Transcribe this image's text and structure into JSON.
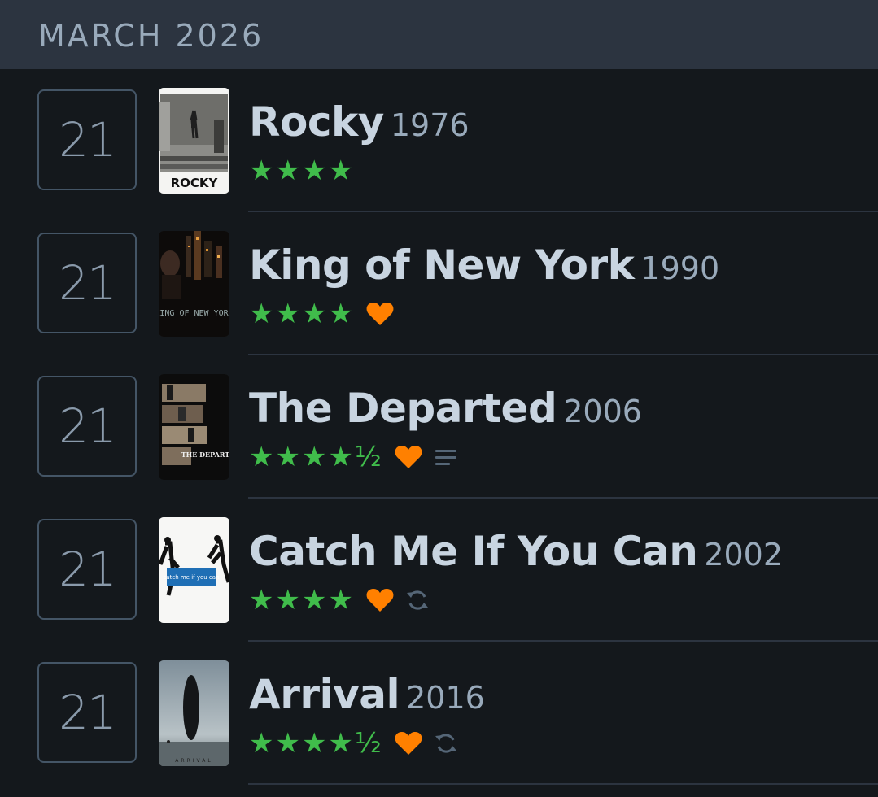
{
  "month": "MARCH 2026",
  "colors": {
    "header_bg": "#2c3440",
    "page_bg": "#14181c",
    "star": "#40bc4b",
    "heart": "#ff8000",
    "muted_icon": "#678"
  },
  "entries": [
    {
      "day": "21",
      "title": "Rocky",
      "year": "1976",
      "rating_text": "★★★★",
      "rating": 4,
      "liked": false,
      "review": false,
      "rewatch": false,
      "poster_text": "ROCKY"
    },
    {
      "day": "21",
      "title": "King of New York",
      "year": "1990",
      "rating_text": "★★★★",
      "rating": 4,
      "liked": true,
      "review": false,
      "rewatch": false,
      "poster_text": "KING OF NEW YORK"
    },
    {
      "day": "21",
      "title": "The Departed",
      "year": "2006",
      "rating_text": "★★★★½",
      "rating": 4.5,
      "liked": true,
      "review": true,
      "rewatch": false,
      "poster_text": "THE DEPARTED"
    },
    {
      "day": "21",
      "title": "Catch Me If You Can",
      "year": "2002",
      "rating_text": "★★★★",
      "rating": 4,
      "liked": true,
      "review": false,
      "rewatch": true,
      "poster_text": "catch me if you can"
    },
    {
      "day": "21",
      "title": "Arrival",
      "year": "2016",
      "rating_text": "★★★★½",
      "rating": 4.5,
      "liked": true,
      "review": false,
      "rewatch": true,
      "poster_text": "ARRIVAL"
    }
  ]
}
